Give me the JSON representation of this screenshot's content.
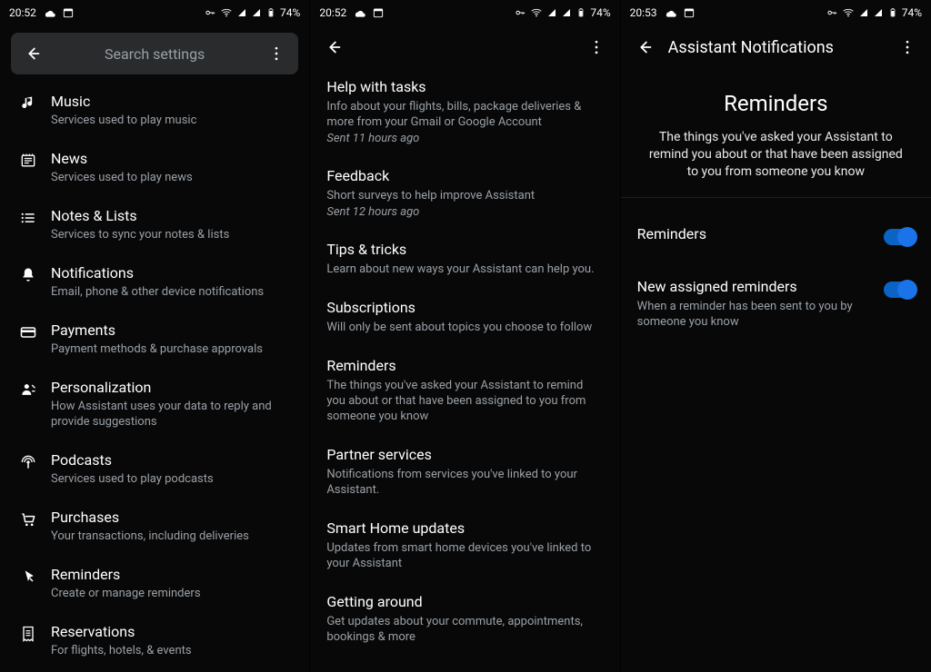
{
  "status": {
    "time_a": "20:52",
    "time_b": "20:52",
    "time_c": "20:53",
    "battery": "74%"
  },
  "pane1": {
    "search_placeholder": "Search settings",
    "items": [
      {
        "icon": "music",
        "title": "Music",
        "sub": "Services used to play music"
      },
      {
        "icon": "news",
        "title": "News",
        "sub": "Services used to play news"
      },
      {
        "icon": "list",
        "title": "Notes & Lists",
        "sub": "Services to sync your notes & lists"
      },
      {
        "icon": "bell",
        "title": "Notifications",
        "sub": "Email, phone & other device notifications"
      },
      {
        "icon": "card",
        "title": "Payments",
        "sub": "Payment methods & purchase approvals"
      },
      {
        "icon": "person",
        "title": "Personalization",
        "sub": "How Assistant uses your data to reply and provide suggestions"
      },
      {
        "icon": "podcast",
        "title": "Podcasts",
        "sub": "Services used to play podcasts"
      },
      {
        "icon": "cart",
        "title": "Purchases",
        "sub": "Your transactions, including deliveries"
      },
      {
        "icon": "pointer",
        "title": "Reminders",
        "sub": "Create or manage reminders"
      },
      {
        "icon": "receipt",
        "title": "Reservations",
        "sub": "For flights, hotels, & events"
      }
    ]
  },
  "pane2": {
    "items": [
      {
        "title": "Help with tasks",
        "sub": "Info about your flights, bills, package deliveries & more from your Gmail or Google Account",
        "meta": "Sent 11 hours ago"
      },
      {
        "title": "Feedback",
        "sub": "Short surveys to help improve Assistant",
        "meta": "Sent 12 hours ago"
      },
      {
        "title": "Tips & tricks",
        "sub": "Learn about new ways your Assistant can help you."
      },
      {
        "title": "Subscriptions",
        "sub": "Will only be sent about topics you choose to follow"
      },
      {
        "title": "Reminders",
        "sub": "The things you've asked your Assistant to remind you about or that have been assigned to you from someone you know"
      },
      {
        "title": "Partner services",
        "sub": "Notifications from services you've linked to your Assistant."
      },
      {
        "title": "Smart Home updates",
        "sub": "Updates from smart home devices you've linked to your Assistant"
      },
      {
        "title": "Getting around",
        "sub": "Get updates about your commute, appointments, bookings & more"
      }
    ]
  },
  "pane3": {
    "appbar_title": "Assistant Notifications",
    "header": {
      "title": "Reminders",
      "desc": "The things you've asked your Assistant to remind you about or that have been assigned to you from someone you know"
    },
    "toggles": [
      {
        "title": "Reminders",
        "on": true
      },
      {
        "title": "New assigned reminders",
        "sub": "When a reminder has been sent to you by someone you know",
        "on": true
      }
    ]
  }
}
